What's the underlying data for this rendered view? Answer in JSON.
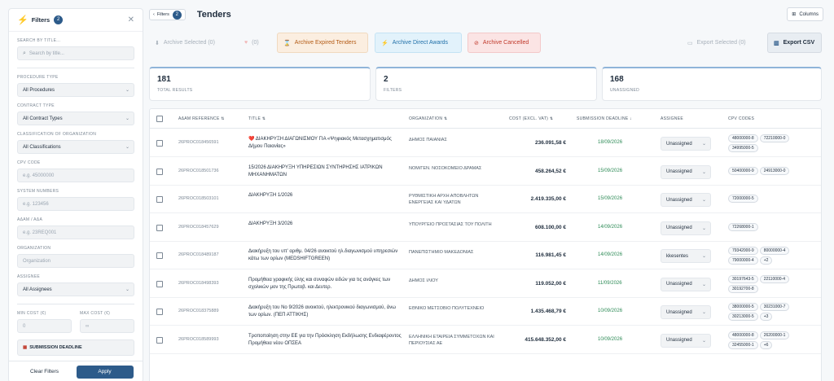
{
  "sidebar": {
    "title": "Filters",
    "badge": "2",
    "search_title_label": "SEARCH BY TITLE...",
    "search_placeholder": "Search by title...",
    "procedure_label": "PROCEDURE TYPE",
    "procedure_value": "All Procedures",
    "contract_label": "CONTRACT TYPE",
    "contract_value": "All Contract Types",
    "classification_label": "CLASSIFICATION OF ORGANIZATION",
    "classification_value": "All Classifications",
    "cpv_label": "CPV CODE",
    "cpv_placeholder": "e.g. 45000000",
    "system_label": "SYSTEM NUMBERS",
    "system_placeholder": "e.g. 123456",
    "adam_label": "ΑΔΑΜ / ΑΔΑ",
    "adam_placeholder": "e.g. 23REQ001",
    "organization_label": "ORGANIZATION",
    "organization_placeholder": "Organization",
    "assignee_label": "ASSIGNEE",
    "assignee_value": "All Assignees",
    "min_cost_label": "MIN COST (€)",
    "min_cost_placeholder": "0",
    "max_cost_label": "MAX COST (€)",
    "max_cost_placeholder": "∞",
    "deadline_label": "SUBMISSION DEADLINE",
    "clear_label": "Clear Filters",
    "apply_label": "Apply"
  },
  "topbar": {
    "filters_label": "Filters",
    "filters_badge": "2",
    "page_title": "Tenders",
    "columns_label": "Columns"
  },
  "actions": {
    "archive_selected": "Archive Selected (0)",
    "favorite_count": "(0)",
    "archive_expired": "Archive Expired Tenders",
    "archive_direct": "Archive Direct Awards",
    "archive_cancelled": "Archive Cancelled",
    "export_selected": "Export Selected (0)",
    "export_csv": "Export CSV"
  },
  "stats": [
    {
      "value": "181",
      "label": "TOTAL RESULTS"
    },
    {
      "value": "2",
      "label": "FILTERS"
    },
    {
      "value": "168",
      "label": "UNASSIGNED"
    }
  ],
  "table": {
    "headers": [
      "ΑΔΑΜ REFERENCE ⇅",
      "TITLE ⇅",
      "ORGANIZATION ⇅",
      "COST (EXCL. VAT) ⇅",
      "SUBMISSION DEADLINE ↓",
      "ASSIGNEE",
      "CPV CODES"
    ],
    "rows": [
      {
        "ref": "26PROC018456591",
        "title": "❤️ ΔΙΑΚΗΡΥΞΗ ΔΙΑΓΩΝΙΣΜΟΥ ΓΙΑ «Ψηφιακός Μετασχηματισμός Δήμου Παιανίας»",
        "org": "ΔΗΜΟΣ ΠΑΙΑΝΙΑΣ",
        "cost": "236.091,58 €",
        "deadline": "18/09/2026",
        "assignee": "Unassigned",
        "cpv": [
          "48000000-8",
          "72210000-0",
          "34995000-5"
        ]
      },
      {
        "ref": "26PROC018501736",
        "title": "15/2026 ΔΙΑΚΗΡΥΞΗ ΥΠΗΡΕΣΙΩΝ ΣΥΝΤΗΡΗΣΗΣ ΙΑΤΡΙΚΩΝ ΜΗΧΑΝΗΜΑΤΩΝ",
        "org": "ΝΟΜ/ΓΕΝ. ΝΟΣΟΚΟΜΕΙΟ ΔΡΑΜΑΣ",
        "cost": "458.264,52 €",
        "deadline": "15/09/2026",
        "assignee": "Unassigned",
        "cpv": [
          "50400000-9",
          "24913000-0"
        ]
      },
      {
        "ref": "26PROC018503101",
        "title": "ΔΙΑΚΗΡΥΞΗ 1/2026",
        "org": "ΡΥΘΜΙΣΤΙΚΗ ΑΡΧΗ ΑΠΟΒΛΗΤΩΝ ΕΝΕΡΓΕΙΑΣ ΚΑΙ ΥΔΑΤΩΝ",
        "cost": "2.419.335,00 €",
        "deadline": "15/09/2026",
        "assignee": "Unassigned",
        "cpv": [
          "72000000-5"
        ]
      },
      {
        "ref": "26PROC018457629",
        "title": "ΔΙΑΚΗΡΥΞΗ 3/2026",
        "org": "ΥΠΟΥΡΓΕΙΟ ΠΡΟΣΤΑΣΙΑΣ ΤΟΥ ΠΟΛΙΤΗ",
        "cost": "608.100,00 €",
        "deadline": "14/09/2026",
        "assignee": "Unassigned",
        "cpv": [
          "72268000-1"
        ]
      },
      {
        "ref": "26PROC018489187",
        "title": "Διακήρυξη του υπ' αριθμ. 04/26 ανοικτού ηλ.διαγωνισμού υπηρεσιών κάτω των ορίων (MEDSHIFTGREEN)",
        "org": "ΠΑΝΕΠΙΣΤΗΜΙΟ ΜΑΚΕΔΟΝΙΑΣ",
        "cost": "116.981,45 €",
        "deadline": "14/09/2026",
        "assignee": "kkesentes",
        "cpv": [
          "79342000-9",
          "80000000-4",
          "79000000-4",
          "+2"
        ]
      },
      {
        "ref": "26PROC018498393",
        "title": "Προμήθεια γραφικής ύλης και συναφών ειδών για τις ανάγκες των σχολικών μον της Πρωτοβ. και Δευτερ.",
        "org": "ΔΗΜΟΣ ΙΛΙΟΥ",
        "cost": "119.052,00 €",
        "deadline": "11/09/2026",
        "assignee": "Unassigned",
        "cpv": [
          "30197643-5",
          "22110000-4",
          "30192700-8"
        ]
      },
      {
        "ref": "26PROC018375889",
        "title": "Διακήρυξη του Νο 9/2026 ανοικτού, ηλεκτρονικού διαγωνισμού, άνω των ορίων. (ΠΕΠ ΑΤΤΙΚΗΣ)",
        "org": "ΕΘΝΙΚΟ ΜΕΤΣΟΒΙΟ ΠΟΛΥΤΕΧΝΕΙΟ",
        "cost": "1.435.468,79 €",
        "deadline": "10/09/2026",
        "assignee": "Unassigned",
        "cpv": [
          "38000000-5",
          "30231000-7",
          "30213000-5",
          "+3"
        ]
      },
      {
        "ref": "26PROC018589993",
        "title": "Τροποποίηση στην ΕΕ για την Πρόσκληση Εκδήλωσης Ενδιαφέροντος Προμήθεια νέου ΟΠΣΕΑ",
        "org": "ΕΛΛΗΝΙΚΗ ΕΤΑΙΡΕΙΑ ΣΥΜΜΕΤΟΧΩΝ ΚΑΙ ΠΕΡΙΟΥΣΙΑΣ ΑΕ",
        "cost": "415.648.352,00 €",
        "deadline": "10/09/2026",
        "assignee": "Unassigned",
        "cpv": [
          "48000000-8",
          "26200000-1",
          "32455000-1",
          "+6"
        ]
      }
    ]
  }
}
